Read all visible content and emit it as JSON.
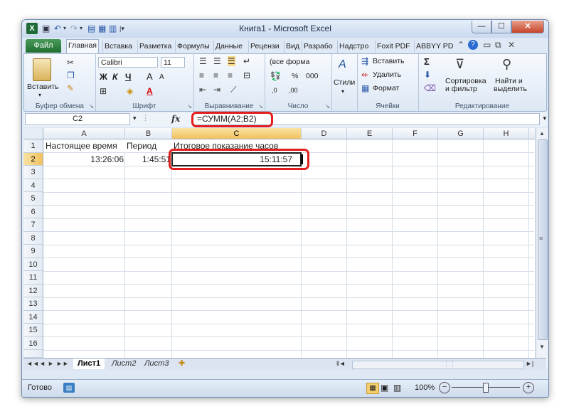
{
  "window": {
    "title": "Книга1 - Microsoft Excel",
    "controls": {
      "minimize": "—",
      "maximize": "☐",
      "close": "✕"
    }
  },
  "quick_access": {
    "save": "💾",
    "undo": "↶",
    "redo": "↷"
  },
  "ribbon_tabs": {
    "file": "Файл",
    "items": [
      "Главная",
      "Вставка",
      "Разметка",
      "Формулы",
      "Данные",
      "Рецензи",
      "Вид",
      "Разрабо",
      "Надстро",
      "Foxit PDF",
      "ABBYY PD"
    ],
    "active_index": 0
  },
  "ribbon": {
    "clipboard": {
      "paste": "Вставить",
      "label": "Буфер обмена"
    },
    "font": {
      "name": "Calibri",
      "size": "11",
      "bold": "Ж",
      "italic": "К",
      "underline": "Ч",
      "grow": "A",
      "shrink": "A",
      "label": "Шрифт"
    },
    "alignment": {
      "label": "Выравнивание"
    },
    "number": {
      "format": "(все форма",
      "percent": "%",
      "thousands": "000",
      "inc_dec": ",0",
      "dec_dec": ",00",
      "label": "Число"
    },
    "styles": {
      "label": "Стили"
    },
    "cells": {
      "insert": "Вставить",
      "delete": "Удалить",
      "format": "Формат",
      "label": "Ячейки"
    },
    "editing": {
      "sum": "Σ",
      "sort": "Сортировка",
      "sort2": "и фильтр",
      "find": "Найти и",
      "find2": "выделить",
      "label": "Редактирование"
    }
  },
  "formula_bar": {
    "name_box": "C2",
    "fx": "fx",
    "formula": "=СУММ(A2;B2)"
  },
  "columns": [
    "A",
    "B",
    "C",
    "D",
    "E",
    "F",
    "G",
    "H"
  ],
  "selected_column": "C",
  "rows": [
    "1",
    "2",
    "3",
    "4",
    "5",
    "6",
    "7",
    "8",
    "9",
    "10",
    "11",
    "12",
    "13",
    "14",
    "15",
    "16"
  ],
  "selected_row": "2",
  "cells": {
    "A1": "Настоящее время",
    "B1": "Период",
    "C1": "Итоговое показание часов",
    "A2": "13:26:06",
    "B2": "1:45:51",
    "C2": "15:11:57"
  },
  "sheets": {
    "nav": [
      "◄◄",
      "◄",
      "►",
      "►►"
    ],
    "tabs": [
      "Лист1",
      "Лист2",
      "Лист3"
    ],
    "active": "Лист1"
  },
  "status": {
    "ready": "Готово",
    "zoom": "100%",
    "zoom_out": "−",
    "zoom_in": "+"
  },
  "colors": {
    "accent": "#1f6b36",
    "highlight_box": "#e21f1f",
    "header_selected": "#f1c15f"
  }
}
